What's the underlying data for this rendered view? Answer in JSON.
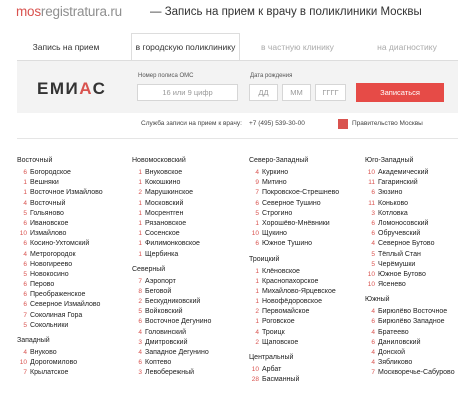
{
  "header": {
    "logo_part1": "mos",
    "logo_part2": "registratura.ru",
    "tagline": "— Запись на прием к врачу в поликлиники Москвы"
  },
  "tabs": [
    "Запись на прием",
    "в городскую поликлинику",
    "в частную клинику",
    "на диагностику"
  ],
  "form": {
    "logo_left": "ЕМИ",
    "logo_red": "А",
    "logo_right": "С",
    "policy_label": "Номер полиса ОМС",
    "policy_placeholder": "16 или 9 цифр",
    "dob_label": "Дата рождения",
    "dd": "ДД",
    "mm": "ММ",
    "yyyy": "ГГГГ",
    "submit": "Записаться"
  },
  "info": {
    "service": "Служба записи на прием к врачу:",
    "phone": "+7 (495) 539-30-00",
    "gov": "Правительство Москвы"
  },
  "columns": [
    {
      "groups": [
        {
          "name": "Восточный",
          "items": [
            [
              "6",
              "Богородское"
            ],
            [
              "1",
              "Вешняки"
            ],
            [
              "1",
              "Восточное Измайлово"
            ],
            [
              "4",
              "Восточный"
            ],
            [
              "5",
              "Гольяново"
            ],
            [
              "6",
              "Ивановское"
            ],
            [
              "10",
              "Измайлово"
            ],
            [
              "6",
              "Косино-Ухтомский"
            ],
            [
              "4",
              "Метрогородок"
            ],
            [
              "6",
              "Новогиреево"
            ],
            [
              "5",
              "Новокосино"
            ],
            [
              "6",
              "Перово"
            ],
            [
              "6",
              "Преображенское"
            ],
            [
              "6",
              "Северное Измайлово"
            ],
            [
              "7",
              "Соколиная Гора"
            ],
            [
              "5",
              "Сокольники"
            ]
          ]
        },
        {
          "name": "Западный",
          "items": [
            [
              "4",
              "Внуково"
            ],
            [
              "10",
              "Дорогомилово"
            ],
            [
              "7",
              "Крылатское"
            ]
          ]
        }
      ]
    },
    {
      "groups": [
        {
          "name": "Новомосковский",
          "items": [
            [
              "1",
              "Внуковское"
            ],
            [
              "1",
              "Кокошкино"
            ],
            [
              "2",
              "Марушкинское"
            ],
            [
              "1",
              "Московский"
            ],
            [
              "1",
              "Мосрентген"
            ],
            [
              "1",
              "Рязановское"
            ],
            [
              "1",
              "Сосенское"
            ],
            [
              "1",
              "Филимонковское"
            ],
            [
              "1",
              "Щербинка"
            ]
          ]
        },
        {
          "name": "Северный",
          "items": [
            [
              "7",
              "Аэропорт"
            ],
            [
              "8",
              "Беговой"
            ],
            [
              "2",
              "Бескудниковский"
            ],
            [
              "5",
              "Войковский"
            ],
            [
              "6",
              "Восточное Дегунино"
            ],
            [
              "4",
              "Головинский"
            ],
            [
              "3",
              "Дмитровский"
            ],
            [
              "4",
              "Западное Дегунино"
            ],
            [
              "6",
              "Коптево"
            ],
            [
              "3",
              "Левобережный"
            ]
          ]
        }
      ]
    },
    {
      "groups": [
        {
          "name": "Северо-Западный",
          "items": [
            [
              "4",
              "Куркино"
            ],
            [
              "9",
              "Митино"
            ],
            [
              "7",
              "Покровское-Стрешнево"
            ],
            [
              "6",
              "Северное Тушино"
            ],
            [
              "5",
              "Строгино"
            ],
            [
              "1",
              "Хорошёво-Мнёвники"
            ],
            [
              "10",
              "Щукино"
            ],
            [
              "6",
              "Южное Тушино"
            ]
          ]
        },
        {
          "name": "Троицкий",
          "items": [
            [
              "1",
              "Клёновское"
            ],
            [
              "1",
              "Краснопахорское"
            ],
            [
              "1",
              "Михайлово-Ярцевское"
            ],
            [
              "1",
              "Новофёдоровское"
            ],
            [
              "2",
              "Первомайское"
            ],
            [
              "1",
              "Роговское"
            ],
            [
              "4",
              "Троицк"
            ],
            [
              "2",
              "Щаповское"
            ]
          ]
        },
        {
          "name": "Центральный",
          "items": [
            [
              "10",
              "Арбат"
            ],
            [
              "28",
              "Басманный"
            ]
          ]
        }
      ]
    },
    {
      "groups": [
        {
          "name": "Юго-Западный",
          "items": [
            [
              "10",
              "Академический"
            ],
            [
              "11",
              "Гагаринский"
            ],
            [
              "6",
              "Зюзино"
            ],
            [
              "11",
              "Коньково"
            ],
            [
              "3",
              "Котловка"
            ],
            [
              "6",
              "Ломоносовский"
            ],
            [
              "6",
              "Обручевский"
            ],
            [
              "4",
              "Северное Бутово"
            ],
            [
              "5",
              "Тёплый Стан"
            ],
            [
              "5",
              "Черёмушки"
            ],
            [
              "10",
              "Южное Бутово"
            ],
            [
              "10",
              "Ясенево"
            ]
          ]
        },
        {
          "name": "Южный",
          "items": [
            [
              "4",
              "Бирюлёво Восточное"
            ],
            [
              "6",
              "Бирюлёво Западное"
            ],
            [
              "4",
              "Братеево"
            ],
            [
              "6",
              "Даниловский"
            ],
            [
              "4",
              "Донской"
            ],
            [
              "4",
              "Зябликово"
            ],
            [
              "7",
              "Москворечье-Сабурово"
            ]
          ]
        }
      ]
    }
  ]
}
